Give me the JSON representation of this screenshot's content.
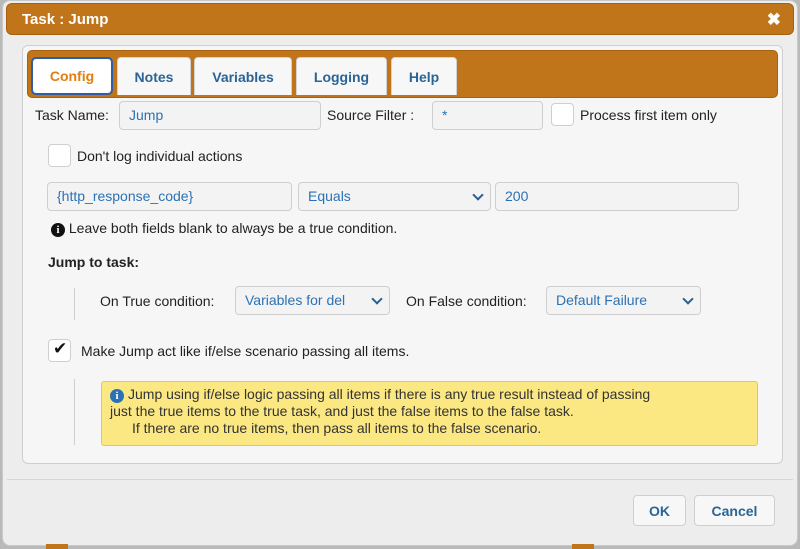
{
  "dialog": {
    "title": "Task : Jump",
    "close_glyph": "✖"
  },
  "tabs": [
    {
      "label": "Config",
      "active": true
    },
    {
      "label": "Notes"
    },
    {
      "label": "Variables"
    },
    {
      "label": "Logging"
    },
    {
      "label": "Help"
    }
  ],
  "config": {
    "task_name_label": "Task Name:",
    "task_name_value": "Jump",
    "source_filter_label": "Source Filter :",
    "source_filter_value": "*",
    "process_first_label": "Process first item only",
    "process_first_checked": false,
    "dont_log_label": "Don't log individual actions",
    "dont_log_checked": false,
    "condition": {
      "left_value": "{http_response_code}",
      "operator": "Equals",
      "right_value": "200"
    },
    "condition_hint": "Leave both fields blank to always be a true condition.",
    "jump_to_task_label": "Jump to task:",
    "on_true_label": "On True condition:",
    "on_true_value": "Variables for del",
    "on_false_label": "On False condition:",
    "on_false_value": "Default Failure",
    "ifelse_label": "Make Jump act like if/else scenario passing all items.",
    "ifelse_checked": true,
    "note_line1": "Jump using if/else logic passing all items if there is any true result instead of passing",
    "note_line2": "just the true items to the true task, and just the false items to the false task.",
    "note_line3": "If there are no true items, then pass all items to the false scenario."
  },
  "footer": {
    "ok_label": "OK",
    "cancel_label": "Cancel"
  },
  "colors": {
    "accent_orange": "#c0751a",
    "link_blue": "#2a6496",
    "note_yellow": "#fbe883"
  },
  "icons": [
    "close-icon",
    "info-icon",
    "checkmark-icon",
    "chevron-down-icon"
  ]
}
